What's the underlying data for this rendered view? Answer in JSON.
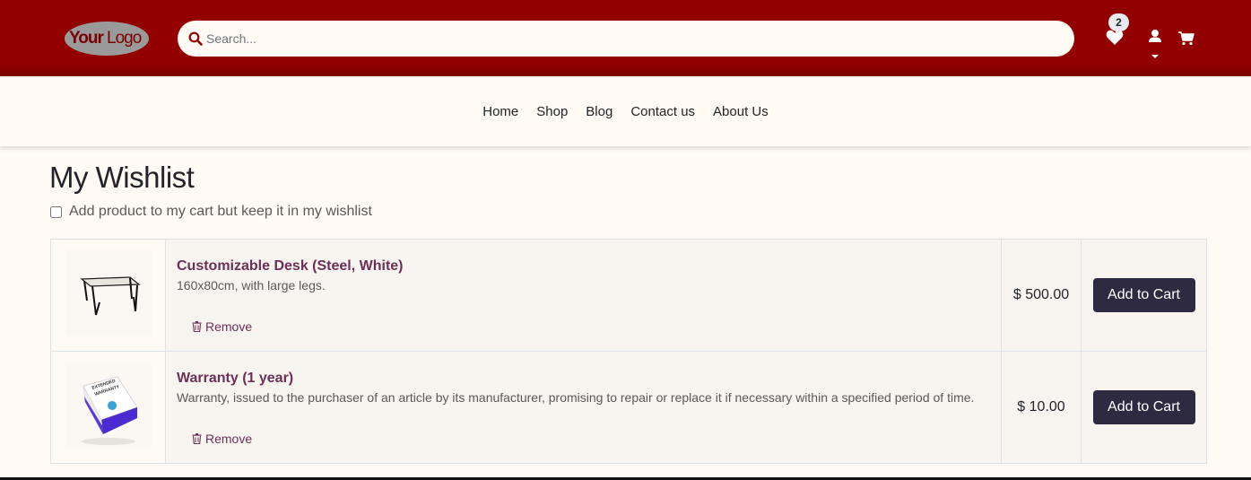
{
  "header": {
    "logo_text": "YourLogo",
    "search_placeholder": "Search...",
    "wishlist_count": "2"
  },
  "nav": {
    "items": [
      "Home",
      "Shop",
      "Blog",
      "Contact us",
      "About Us"
    ]
  },
  "page": {
    "title": "My Wishlist",
    "option_label": "Add product to my cart but keep it in my wishlist"
  },
  "wishlist": {
    "items": [
      {
        "name": "Customizable Desk (Steel, White)",
        "description": "160x80cm, with large legs.",
        "remove_label": "Remove",
        "price": "$ 500.00",
        "button_label": "Add to Cart",
        "image": "desk-image"
      },
      {
        "name": "Warranty (1 year)",
        "description": "Warranty, issued to the purchaser of an article by its manufacturer, promising to repair or replace it if necessary within a specified period of time.",
        "remove_label": "Remove",
        "price": "$ 10.00",
        "button_label": "Add to Cart",
        "image": "warranty-box-image"
      }
    ]
  },
  "colors": {
    "header_bg": "#930000",
    "accent": "#6b3057",
    "button_bg": "#2d2a42",
    "page_bg": "#fffaf3"
  },
  "icons": [
    "search-icon",
    "heart-icon",
    "user-icon",
    "cart-icon",
    "trash-icon"
  ]
}
